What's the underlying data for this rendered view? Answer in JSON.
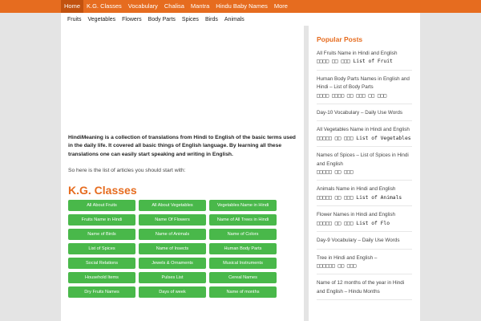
{
  "topnav": {
    "items": [
      "Home",
      "K.G. Classes",
      "Vocabulary",
      "Chalisa",
      "Mantra",
      "Hindu Baby Names",
      "More"
    ]
  },
  "subnav": {
    "items": [
      "Fruits",
      "Vegetables",
      "Flowers",
      "Body Parts",
      "Spices",
      "Birds",
      "Animals"
    ]
  },
  "main": {
    "intro": "HindiMeaning is a collection of translations from Hindi to English of the basic terms used in the daily life. It covered all basic things of English language. By learning all these translations one can easily start speaking and writing in English.",
    "start_text": "So here is the list of articles you should start with:",
    "section_title": "K.G. Classes",
    "buttons": [
      "All About Fruits",
      "All About Vegetables",
      "Vegetables Name in Hindi",
      "Fruits Name in Hindi",
      "Name Of Flowers",
      "Name of All Trees in Hindi",
      "Name of Birds",
      "Name of Animals",
      "Name of Colors",
      "List of Spices",
      "Name of Insects",
      "Human Body Parts",
      "Social Relations",
      "Jewels & Ornaments",
      "Musical Instruments",
      "Household Items",
      "Pulses List",
      "Cereal Names",
      "Dry Fruits Names",
      "Days of week",
      "Name of months"
    ]
  },
  "sidebar": {
    "title": "Popular Posts",
    "items": [
      {
        "text": "All Fruits Name in Hindi and English",
        "extra": "□□□□ □□ □□□ List of Fruit"
      },
      {
        "text": "Human Body Parts Names in English and Hindi – List of Body Parts",
        "extra": "□□□□ □□□□ □□ □□□ □□ □□□"
      },
      {
        "text": "Day-10 Vocabulary – Daily Use Words",
        "extra": ""
      },
      {
        "text": "All Vegetables Name in Hindi and English",
        "extra": "□□□□□ □□ □□□ List of Vegetables"
      },
      {
        "text": "Names of Spices – List of Spices in Hindi and English",
        "extra": "□□□□□ □□ □□□"
      },
      {
        "text": "Animals Name in Hindi and English",
        "extra": "□□□□□ □□ □□□ List of Animals"
      },
      {
        "text": "Flower Names in Hindi and English",
        "extra": "□□□□□ □□ □□□ List of Flo"
      },
      {
        "text": "Day-9 Vocabulary – Daily Use Words",
        "extra": ""
      },
      {
        "text": "Tree in Hindi and English –",
        "extra": "□□□□□□ □□ □□□"
      },
      {
        "text": "Name of 12 months of the year in Hindi and English – Hindu Months",
        "extra": ""
      }
    ]
  }
}
